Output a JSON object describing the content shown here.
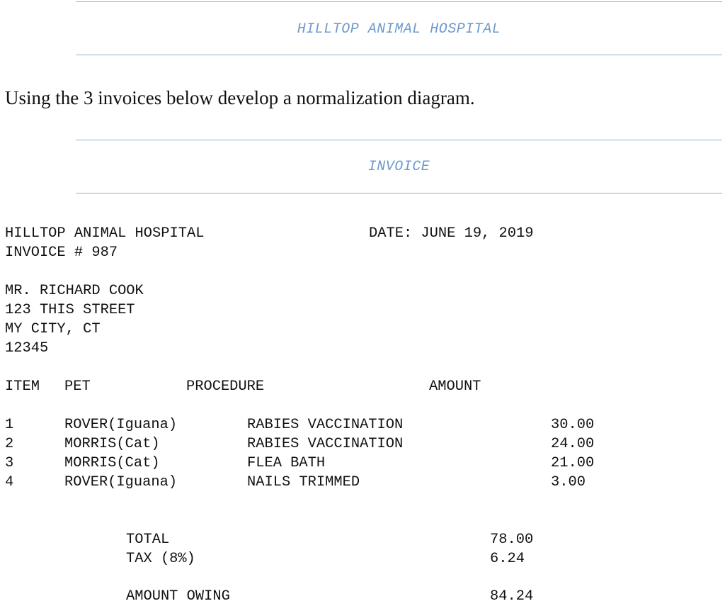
{
  "header": {
    "hospital_banner": "HILLTOP ANIMAL HOSPITAL",
    "instruction": "Using the 3 invoices below develop a normalization diagram.",
    "invoice_banner": "INVOICE"
  },
  "invoice": {
    "hospital_name": "HILLTOP ANIMAL HOSPITAL",
    "date": "DATE: JUNE 19, 2019",
    "invoice_number": "INVOICE # 987",
    "customer": {
      "name": "MR. RICHARD COOK",
      "street": "123 THIS STREET",
      "city_state": "MY CITY, CT",
      "zip": "12345"
    },
    "columns": {
      "item": "ITEM",
      "pet": "PET",
      "procedure": "PROCEDURE",
      "amount": "AMOUNT"
    },
    "line_items": [
      {
        "item": "1",
        "pet": "ROVER(Iguana)",
        "procedure": "RABIES VACCINATION",
        "amount": "30.00"
      },
      {
        "item": "2",
        "pet": "MORRIS(Cat)",
        "procedure": "RABIES VACCINATION",
        "amount": "24.00"
      },
      {
        "item": "3",
        "pet": "MORRIS(Cat)",
        "procedure": "FLEA BATH",
        "amount": "21.00"
      },
      {
        "item": "4",
        "pet": "ROVER(Iguana)",
        "procedure": "NAILS TRIMMED",
        "amount": "3.00"
      }
    ],
    "totals": {
      "total_label": "TOTAL",
      "total_value": "78.00",
      "tax_label": "TAX (8%)",
      "tax_value": "6.24",
      "owing_label": "AMOUNT OWING",
      "owing_value": "84.24"
    }
  },
  "colors": {
    "banner_text": "#6e9acb",
    "rule": "#8fb0d2",
    "body_text": "#111111"
  }
}
